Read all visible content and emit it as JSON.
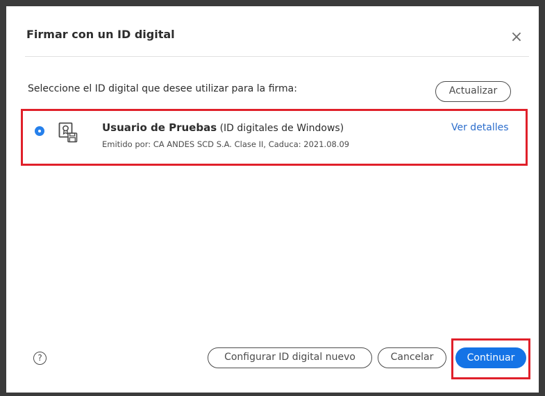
{
  "dialog": {
    "title": "Firmar con un ID digital",
    "close_icon": "close-icon"
  },
  "instruction": "Seleccione el ID digital que desee utilizar para la firma:",
  "refresh_label": "Actualizar",
  "digital_id": {
    "selected": true,
    "name": "Usuario de Pruebas",
    "type": "(ID digitales de Windows)",
    "issuer": "Emitido por: CA ANDES SCD S.A. Clase II, Caduca: 2021.08.09",
    "details_label": "Ver detalles",
    "icon": "certificate-icon"
  },
  "footer": {
    "help_icon": "help-icon",
    "help_glyph": "?",
    "configure_label": "Configurar ID digital nuevo",
    "cancel_label": "Cancelar",
    "continue_label": "Continuar"
  },
  "colors": {
    "accent": "#1473e6",
    "link": "#2b6dcc",
    "highlight": "#e0202a"
  }
}
